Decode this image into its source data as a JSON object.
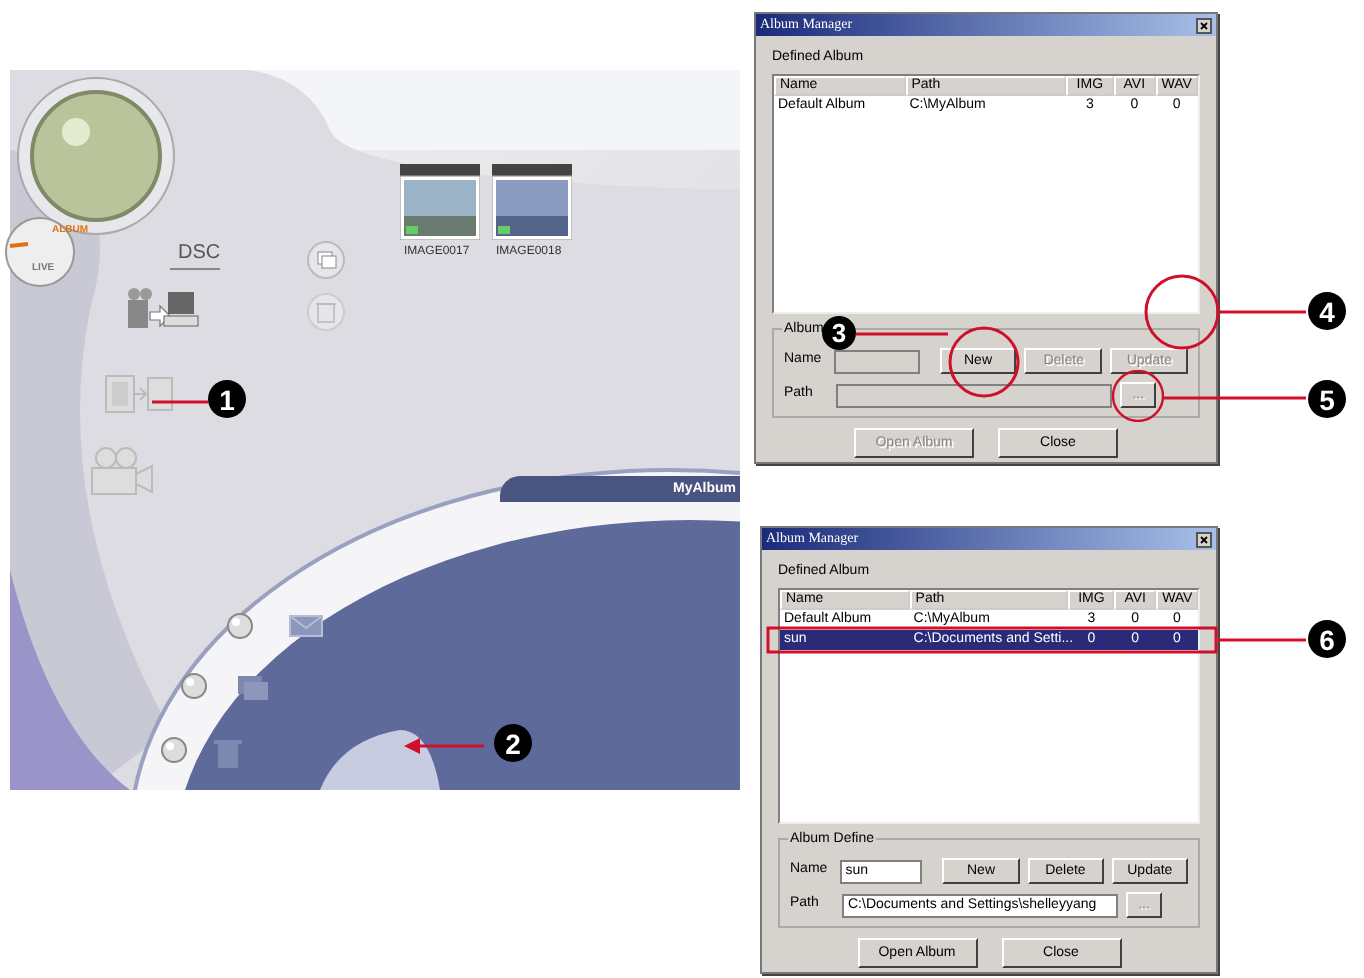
{
  "app": {
    "mode_dial": [
      {
        "label": "ALBUM",
        "selected": true
      },
      {
        "label": "LIVE",
        "selected": false
      }
    ],
    "device_label": "DSC",
    "thumbnails": [
      {
        "caption": "IMAGE0017"
      },
      {
        "caption": "IMAGE0018"
      }
    ],
    "album_bar": "MyAlbum"
  },
  "dialogs": [
    {
      "title": "Album Manager",
      "list_label": "Defined Album",
      "columns": [
        "Name",
        "Path",
        "IMG",
        "AVI",
        "WAV"
      ],
      "rows": [
        {
          "cells": [
            "Default Album",
            "C:\\MyAlbum",
            "3",
            "0",
            "0"
          ],
          "selected": false
        }
      ],
      "group_label": "Album",
      "name_label": "Name",
      "path_label": "Path",
      "buttons": [
        {
          "label": "New",
          "disabled": false
        },
        {
          "label": "Delete",
          "disabled": true
        },
        {
          "label": "Update",
          "disabled": true
        }
      ],
      "browse": {
        "label": "...",
        "disabled": true
      },
      "footer_buttons": [
        {
          "label": "Open Album",
          "disabled": true
        },
        {
          "label": "Close",
          "disabled": false
        }
      ]
    },
    {
      "title": "Album Manager",
      "list_label": "Defined Album",
      "columns": [
        "Name",
        "Path",
        "IMG",
        "AVI",
        "WAV"
      ],
      "rows": [
        {
          "cells": [
            "Default Album",
            "C:\\MyAlbum",
            "3",
            "0",
            "0"
          ],
          "selected": false
        },
        {
          "cells": [
            "sun",
            "C:\\Documents and Setti...",
            "0",
            "0",
            "0"
          ],
          "selected": true
        }
      ],
      "group_label": "Album Define",
      "name_label": "Name",
      "name_value": "sun",
      "path_label": "Path",
      "path_value": "C:\\Documents and Settings\\shelleyyang",
      "buttons": [
        {
          "label": "New",
          "disabled": false
        },
        {
          "label": "Delete",
          "disabled": false
        },
        {
          "label": "Update",
          "disabled": false
        }
      ],
      "browse": {
        "label": "...",
        "disabled": true
      },
      "footer_buttons": [
        {
          "label": "Open Album",
          "disabled": false
        },
        {
          "label": "Close",
          "disabled": false
        }
      ]
    }
  ],
  "callouts": [
    {
      "number": "1"
    },
    {
      "number": "2"
    },
    {
      "number": "3"
    },
    {
      "number": "4"
    },
    {
      "number": "5"
    },
    {
      "number": "6"
    }
  ]
}
